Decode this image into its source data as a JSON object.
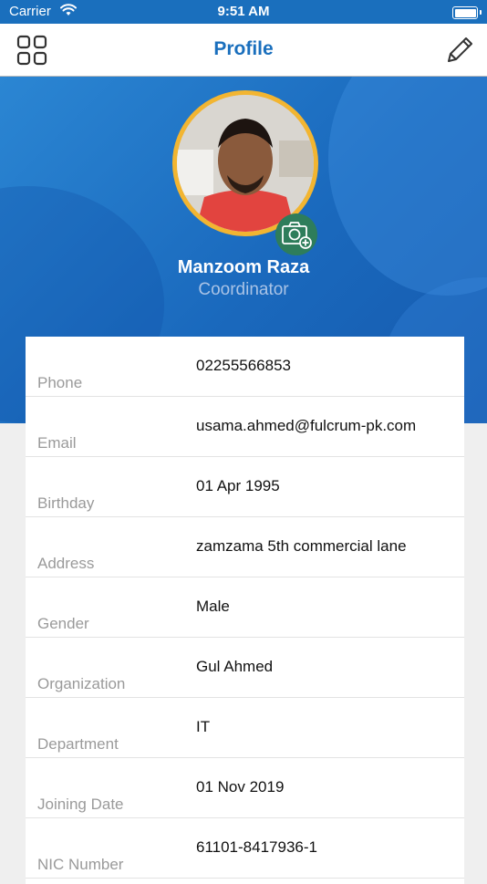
{
  "status_bar": {
    "carrier": "Carrier",
    "time": "9:51 AM"
  },
  "nav": {
    "title": "Profile",
    "left_icon": "grid-icon",
    "right_icon": "pencil-icon"
  },
  "profile": {
    "name": "Manzoom Raza",
    "role": "Coordinator",
    "camera_icon": "camera-add-icon"
  },
  "colors": {
    "accent": "#1a6fbd",
    "avatar_ring": "#f2b531",
    "camera_badge": "#2e7d5b"
  },
  "fields": [
    {
      "label": "Phone",
      "value": "02255566853"
    },
    {
      "label": "Email",
      "value": "usama.ahmed@fulcrum-pk.com"
    },
    {
      "label": "Birthday",
      "value": "01 Apr 1995"
    },
    {
      "label": "Address",
      "value": "zamzama 5th commercial lane"
    },
    {
      "label": "Gender",
      "value": "Male"
    },
    {
      "label": "Organization",
      "value": "Gul Ahmed"
    },
    {
      "label": "Department",
      "value": "IT"
    },
    {
      "label": "Joining Date",
      "value": "01 Nov 2019"
    },
    {
      "label": "NIC Number",
      "value": "61101-8417936-1"
    }
  ]
}
